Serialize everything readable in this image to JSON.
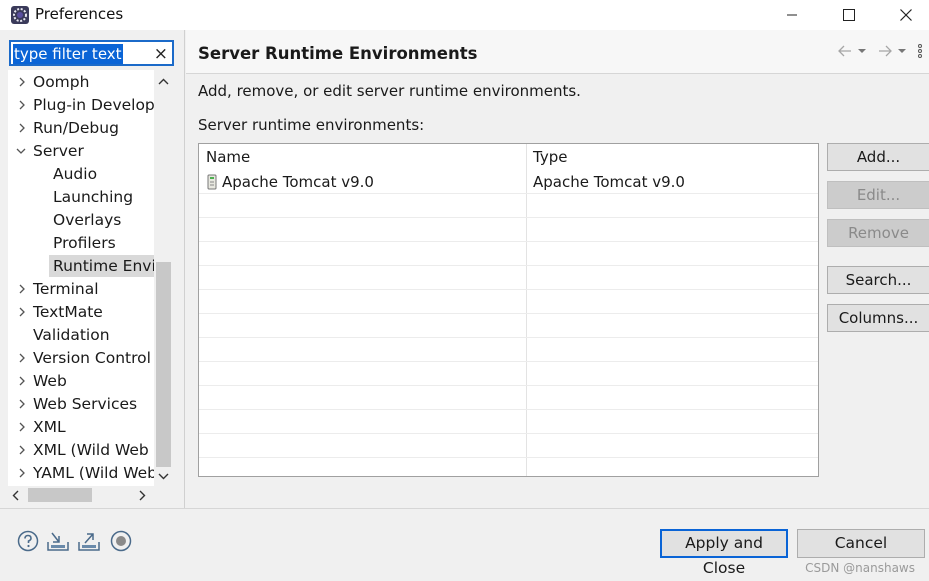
{
  "window": {
    "title": "Preferences",
    "icon": "eclipse-gear-icon",
    "controls": [
      "minimize-icon",
      "maximize-icon",
      "close-icon"
    ]
  },
  "filter": {
    "value": "type filter text",
    "clear_icon": "×"
  },
  "tree": {
    "items": [
      {
        "label": "Oomph",
        "chevron": "›"
      },
      {
        "label": "Plug-in Developr",
        "chevron": "›"
      },
      {
        "label": "Run/Debug",
        "chevron": "›"
      },
      {
        "label": "Server",
        "chevron": "⌄"
      },
      {
        "label": "Audio"
      },
      {
        "label": "Launching"
      },
      {
        "label": "Overlays"
      },
      {
        "label": "Profilers"
      },
      {
        "label": "Runtime Envir",
        "selected": true
      },
      {
        "label": "Terminal",
        "chevron": "›"
      },
      {
        "label": "TextMate",
        "chevron": "›"
      },
      {
        "label": "Validation"
      },
      {
        "label": "Version Control (",
        "chevron": "›"
      },
      {
        "label": "Web",
        "chevron": "›"
      },
      {
        "label": "Web Services",
        "chevron": "›"
      },
      {
        "label": "XML",
        "chevron": "›"
      },
      {
        "label": "XML (Wild Web I",
        "chevron": "›"
      },
      {
        "label": "YAML (Wild Web",
        "chevron": "›"
      }
    ]
  },
  "page": {
    "title": "Server Runtime Environments",
    "description": "Add, remove, or edit server runtime environments.",
    "list_label": "Server runtime environments:"
  },
  "table": {
    "columns": [
      "Name",
      "Type"
    ],
    "rows": [
      {
        "name": "Apache Tomcat v9.0",
        "type": "Apache Tomcat v9.0",
        "icon": "server-icon"
      }
    ]
  },
  "buttons": {
    "add": "Add...",
    "edit": "Edit...",
    "remove": "Remove",
    "search": "Search...",
    "columns": "Columns...",
    "apply_close": "Apply and Close",
    "cancel": "Cancel"
  },
  "bottom_icons": [
    "help-icon",
    "import-icon",
    "export-icon",
    "record-icon"
  ],
  "watermark": "CSDN @nanshaws",
  "colors": {
    "accent": "#0a64d6",
    "selection": "#d9d9d9"
  }
}
